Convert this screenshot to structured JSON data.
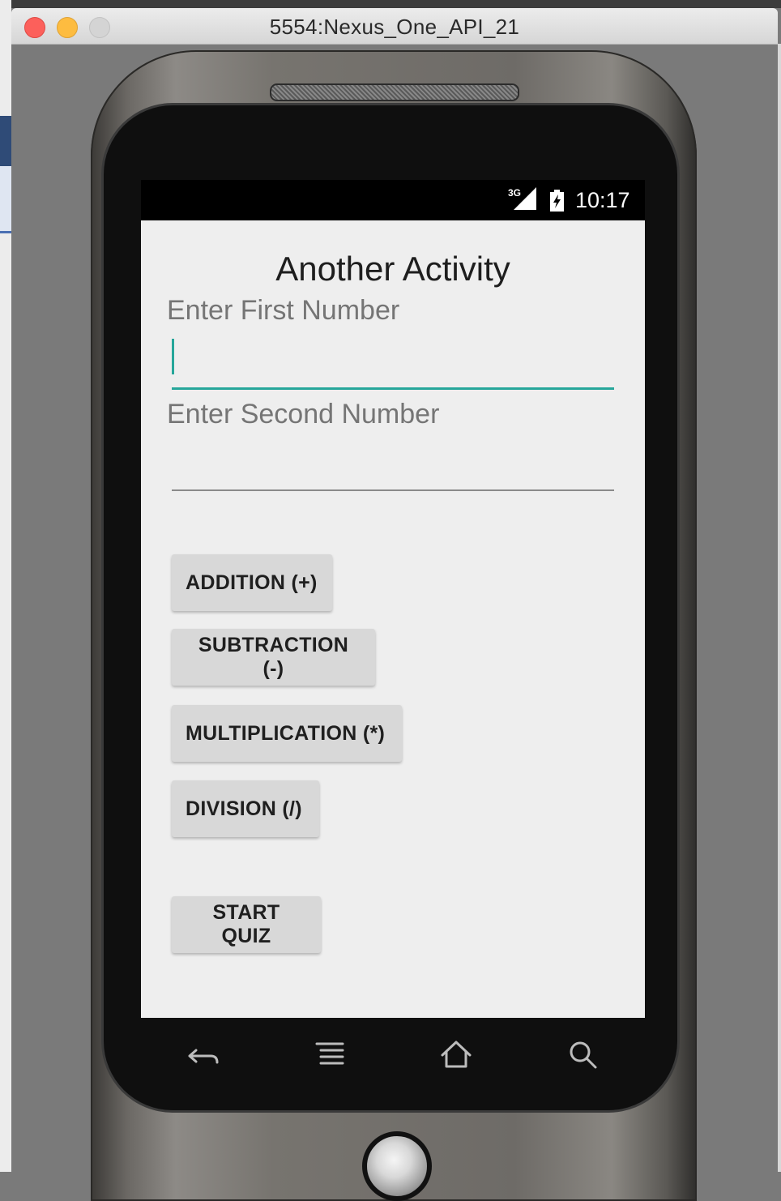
{
  "window": {
    "title": "5554:Nexus_One_API_21"
  },
  "statusbar": {
    "network": "3G",
    "time": "10:17"
  },
  "app": {
    "title": "Another Activity",
    "first_label": "Enter First Number",
    "first_value": "",
    "second_label": "Enter Second Number",
    "second_value": "",
    "buttons": {
      "addition": "ADDITION (+)",
      "subtraction": "SUBTRACTION (-)",
      "multiplication": "MULTIPLICATION (*)",
      "division": "DIVISION (/)",
      "start_quiz": "START QUIZ"
    }
  },
  "nav": {
    "back_icon": "back-icon",
    "menu_icon": "menu-icon",
    "home_icon": "home-icon",
    "search_icon": "search-icon"
  },
  "colors": {
    "accent": "#26a69a",
    "screen_bg": "#eeeeee",
    "button_bg": "#d8d8d8"
  }
}
